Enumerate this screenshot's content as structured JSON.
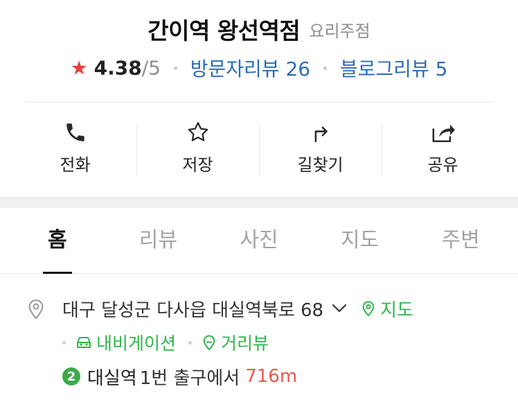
{
  "place": {
    "name": "간이역 왕선역점",
    "category": "요리주점"
  },
  "rating": {
    "score": "4.38",
    "max": "/5",
    "visitor_reviews": "방문자리뷰 26",
    "blog_reviews": "블로그리뷰 5"
  },
  "actions": [
    {
      "label": "전화",
      "icon": "phone-icon"
    },
    {
      "label": "저장",
      "icon": "star-outline-icon"
    },
    {
      "label": "길찾기",
      "icon": "directions-icon"
    },
    {
      "label": "공유",
      "icon": "share-icon"
    }
  ],
  "tabs": [
    {
      "label": "홈",
      "active": true
    },
    {
      "label": "리뷰"
    },
    {
      "label": "사진"
    },
    {
      "label": "지도"
    },
    {
      "label": "주변"
    }
  ],
  "info": {
    "address": "대구 달성군 다사읍 대실역북로 68",
    "map_link": "지도",
    "navigation_link": "내비게이션",
    "street_view_link": "거리뷰",
    "subway_line": "2",
    "station": "대실역",
    "exit": "1번 출구에서",
    "distance": "716m"
  },
  "colors": {
    "star": "#e9403c",
    "link_blue": "#2c6bb4",
    "link_green": "#2db74a",
    "distance_red": "#e85a4f",
    "subway_line2": "#3daa4a"
  }
}
